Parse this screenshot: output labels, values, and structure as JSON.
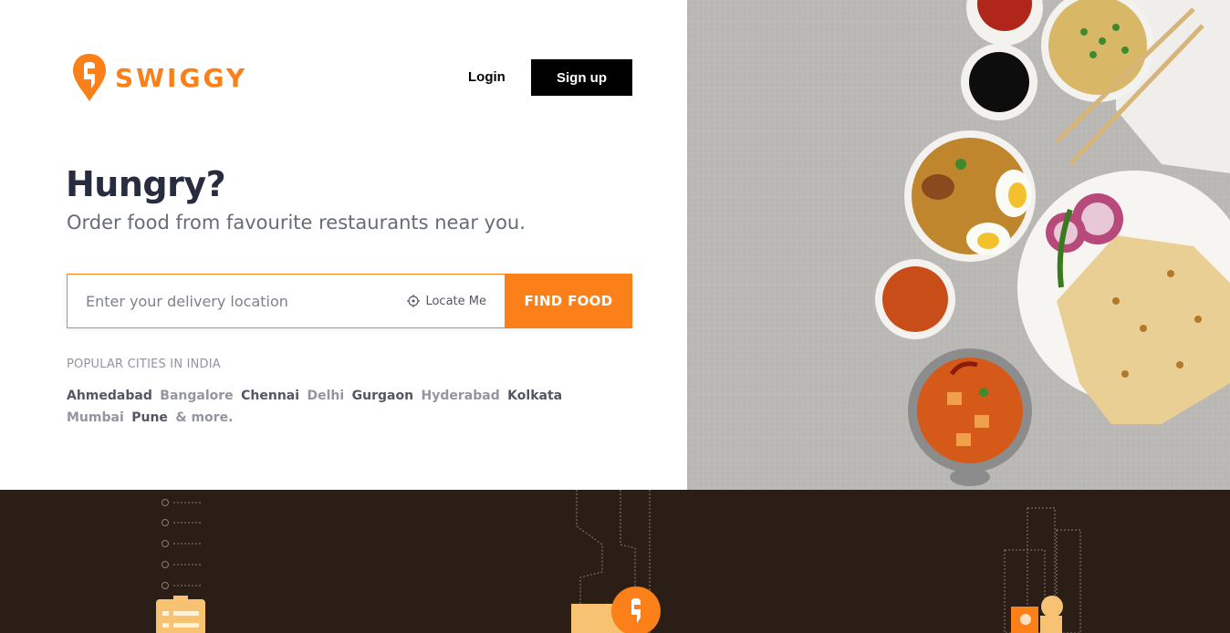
{
  "brand": {
    "name": "SWIGGY",
    "accent_color": "#fc8019"
  },
  "header": {
    "login_label": "Login",
    "signup_label": "Sign up"
  },
  "hero": {
    "headline": "Hungry?",
    "subheadline": "Order food from favourite restaurants near you."
  },
  "search": {
    "placeholder": "Enter your delivery location",
    "value": "",
    "locate_label": "Locate Me",
    "locate_icon": "crosshair-icon",
    "submit_label": "FIND FOOD"
  },
  "popular": {
    "title": "POPULAR CITIES IN INDIA",
    "cities": [
      {
        "name": "Ahmedabad",
        "tone": "dark"
      },
      {
        "name": "Bangalore",
        "tone": "light"
      },
      {
        "name": "Chennai",
        "tone": "dark"
      },
      {
        "name": "Delhi",
        "tone": "light"
      },
      {
        "name": "Gurgaon",
        "tone": "dark"
      },
      {
        "name": "Hyderabad",
        "tone": "light"
      },
      {
        "name": "Kolkata",
        "tone": "dark"
      },
      {
        "name": "Mumbai",
        "tone": "light"
      },
      {
        "name": "Pune",
        "tone": "dark"
      },
      {
        "name": "& more.",
        "tone": "light"
      }
    ]
  },
  "colors": {
    "dark_bg": "#2b1e16",
    "text_dark": "#282c3f",
    "text_muted": "#686b78"
  }
}
